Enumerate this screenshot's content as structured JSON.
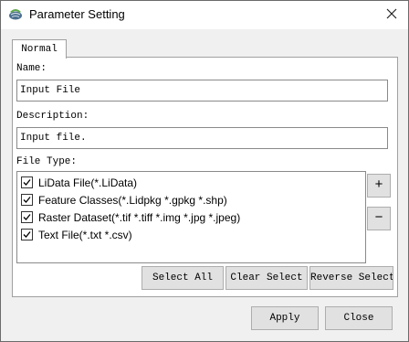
{
  "window": {
    "title": "Parameter Setting",
    "icon": "app-icon",
    "close_label": "close-icon"
  },
  "tabs": [
    {
      "label": "Normal",
      "selected": true
    }
  ],
  "form": {
    "name_label": "Name:",
    "name_value": "Input File",
    "description_label": "Description:",
    "description_value": "Input file.",
    "file_type_label": "File Type:",
    "file_types": [
      {
        "label": "LiData File(*.LiData)",
        "checked": true
      },
      {
        "label": "Feature Classes(*.Lidpkg *.gpkg *.shp)",
        "checked": true
      },
      {
        "label": "Raster Dataset(*.tif *.tiff *.img *.jpg *.jpeg)",
        "checked": true
      },
      {
        "label": "Text File(*.txt *.csv)",
        "checked": true
      }
    ],
    "add_label": "+",
    "remove_label": "−",
    "select_all_label": "Select All",
    "clear_select_label": "Clear Select",
    "reverse_select_label": "Reverse Select"
  },
  "footer": {
    "apply_label": "Apply",
    "close_label": "Close"
  }
}
